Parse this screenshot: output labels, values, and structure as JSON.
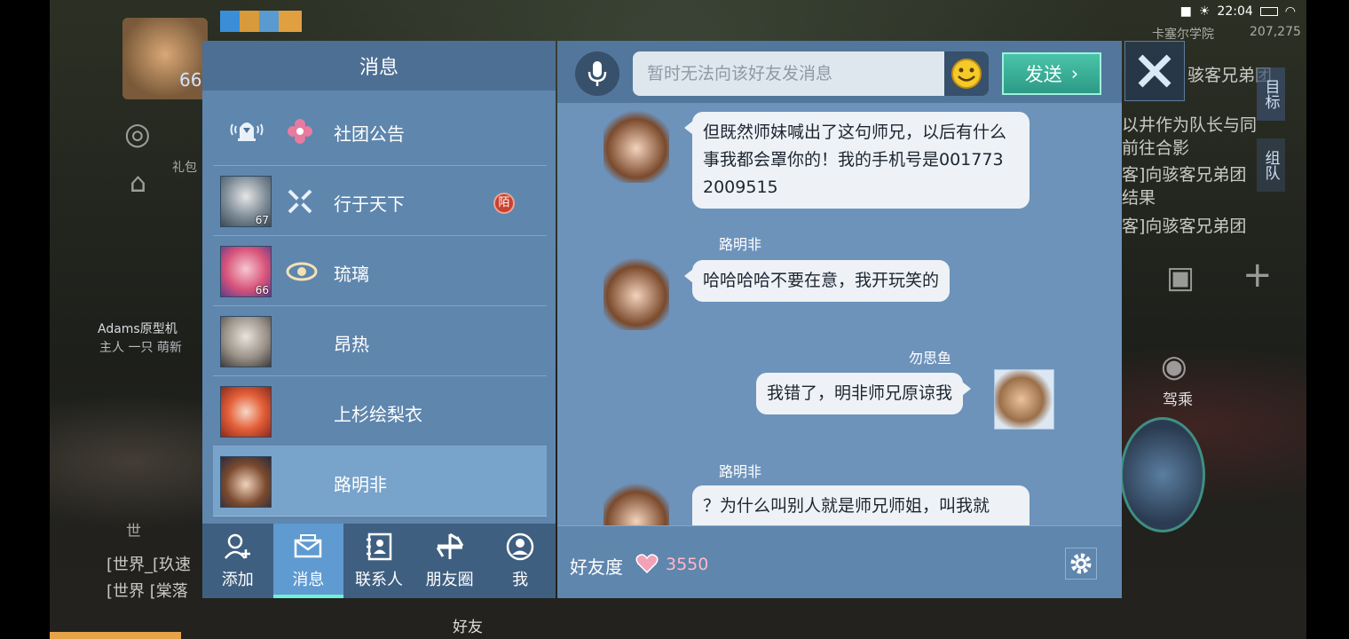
{
  "status_bar": {
    "time": "22:04"
  },
  "game": {
    "location": "卡塞尔学院",
    "coords": "207,275",
    "player_level": "66",
    "player_name": "Adams原型机",
    "player_title": "主人 一只 萌新",
    "gift_label": "礼包",
    "friends_label": "好友",
    "drive_label": "驾乘",
    "target_tab": "目标",
    "team_tab": "组队",
    "quest_lines": [
      "骇客兄弟团",
      "以井作为队长与同",
      "前往合影",
      "客]向骇客兄弟团",
      "结果",
      "客]向骇客兄弟团"
    ],
    "world_chat": [
      "[世界_[玖速",
      "[世界 [棠落"
    ],
    "world_tab": "世"
  },
  "messages_panel": {
    "title": "消息",
    "conversations": [
      {
        "name": "社团公告",
        "level": "",
        "badge": "",
        "icon": "flower-icon",
        "avatar": "bell-icon"
      },
      {
        "name": "行于天下",
        "level": "67",
        "badge": "陌",
        "icon": "crossed-swords-icon",
        "avatar": "white-hair"
      },
      {
        "name": "琉璃",
        "level": "66",
        "badge": "",
        "icon": "eye-emblem-icon",
        "avatar": "pink-hair"
      },
      {
        "name": "昂热",
        "level": "",
        "badge": "",
        "icon": "",
        "avatar": "old-man"
      },
      {
        "name": "上杉绘梨衣",
        "level": "",
        "badge": "",
        "icon": "",
        "avatar": "red-hair"
      },
      {
        "name": "路明非",
        "level": "",
        "badge": "",
        "icon": "",
        "avatar": "brown-hair",
        "selected": true
      }
    ],
    "tabs": [
      {
        "label": "添加",
        "icon": "add-friend-icon"
      },
      {
        "label": "消息",
        "icon": "mail-icon",
        "active": true
      },
      {
        "label": "联系人",
        "icon": "contacts-icon"
      },
      {
        "label": "朋友圈",
        "icon": "moments-icon"
      },
      {
        "label": "我",
        "icon": "me-icon"
      }
    ]
  },
  "chat": {
    "input_placeholder": "暂时无法向该好友发消息",
    "send_label": "发送",
    "messages": [
      {
        "side": "left",
        "sender": "",
        "text": "但既然师妹喊出了这句师兄，以后有什么事我都会罩你的！我的手机号是001773 2009515"
      },
      {
        "side": "left",
        "sender": "路明非",
        "text": "哈哈哈哈不要在意，我开玩笑的"
      },
      {
        "side": "right",
        "sender": "勿思鱼",
        "text": "我错了，明非师兄原谅我"
      },
      {
        "side": "left",
        "sender": "路明非",
        "text": "？为什么叫别人就是师兄师姐，叫我就"
      }
    ],
    "favor_label": "好友度",
    "favor_value": "3550"
  },
  "colors": {
    "panel": "#5f86ad",
    "header": "#4d6f93",
    "send": "#2d9a86",
    "badge": "#c8422f"
  }
}
